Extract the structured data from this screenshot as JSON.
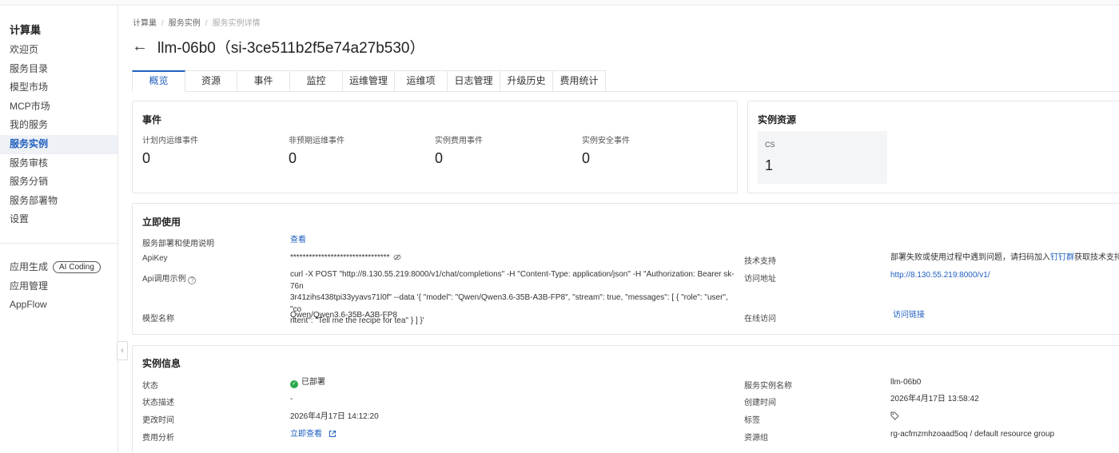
{
  "sidebar": {
    "brand": "计算巢",
    "items": [
      {
        "label": "欢迎页"
      },
      {
        "label": "服务目录"
      },
      {
        "label": "模型市场"
      },
      {
        "label": "MCP市场"
      },
      {
        "label": "我的服务"
      },
      {
        "label": "服务实例"
      },
      {
        "label": "服务审核"
      },
      {
        "label": "服务分销"
      },
      {
        "label": "服务部署物"
      },
      {
        "label": "设置"
      }
    ],
    "secondary": [
      {
        "label": "应用生成",
        "badge": "AI Coding"
      },
      {
        "label": "应用管理"
      },
      {
        "label": "AppFlow"
      }
    ],
    "collapse_glyph": "‹"
  },
  "breadcrumb": {
    "items": [
      "计算巢",
      "服务实例",
      "服务实例详情"
    ],
    "separator": "/"
  },
  "header": {
    "back_glyph": "←",
    "title": "llm-06b0（si-3ce511b2f5e74a27b530）"
  },
  "tabs": [
    {
      "label": "概览"
    },
    {
      "label": "资源"
    },
    {
      "label": "事件"
    },
    {
      "label": "监控"
    },
    {
      "label": "运维管理"
    },
    {
      "label": "运维项"
    },
    {
      "label": "日志管理"
    },
    {
      "label": "升级历史"
    },
    {
      "label": "费用统计"
    }
  ],
  "events": {
    "title": "事件",
    "stats": [
      {
        "label": "计划内运维事件",
        "value": "0"
      },
      {
        "label": "非预期运维事件",
        "value": "0"
      },
      {
        "label": "实例费用事件",
        "value": "0"
      },
      {
        "label": "实例安全事件",
        "value": "0"
      }
    ]
  },
  "resources": {
    "title": "实例资源",
    "label": "CS",
    "value": "1"
  },
  "usage": {
    "title": "立即使用",
    "deploy_label": "服务部署和使用说明",
    "deploy_link": "查看",
    "apikey_label": "ApiKey",
    "apikey_value": "********************************",
    "api_example_label": "Api调用示例",
    "api_example_lines": [
      "curl -X POST \"http://8.130.55.219:8000/v1/chat/completions\" -H \"Content-Type: application/json\" -H \"Authorization: Bearer sk-76n",
      "3r41zihs438tpi33yyavs71l0f\" --data '{ \"model\": \"Qwen/Qwen3.6-35B-A3B-FP8\", \"stream\": true, \"messages\": [ { \"role\": \"user\", \"co",
      "ntent\": \"Tell me the recipe for tea\" } ] }'"
    ],
    "model_label": "模型名称",
    "model_value": "Qwen/Qwen3.6-35B-A3B-FP8",
    "support_label": "技术支持",
    "support_text": "部署失败或使用过程中遇到问题，请扫码加入",
    "support_link": "钉钉群",
    "support_suffix": "获取技术支持",
    "access_label": "访问地址",
    "access_value": "http://8.130.55.219:8000/v1/",
    "online_label": "在线访问",
    "online_link": "访问链接"
  },
  "instance": {
    "title": "实例信息",
    "status_label": "状态",
    "status_value": "已部署",
    "status_color": "#29a94c",
    "desc_label": "状态描述",
    "desc_value": "-",
    "updated_label": "更改时间",
    "updated_value": "2026年4月17日 14:12:20",
    "cost_label": "费用分析",
    "cost_link": "立即查看",
    "name_label": "服务实例名称",
    "name_value": "llm-06b0",
    "created_label": "创建时间",
    "created_value": "2026年4月17日 13:58:42",
    "tags_label": "标签",
    "rg_label": "资源组",
    "rg_value": "rg-acfmzmhzoaad5oq / default resource group"
  },
  "colors": {
    "accent": "#1f5fbf",
    "active_nav_bg": "#eef1f6",
    "success": "#29a94c"
  }
}
